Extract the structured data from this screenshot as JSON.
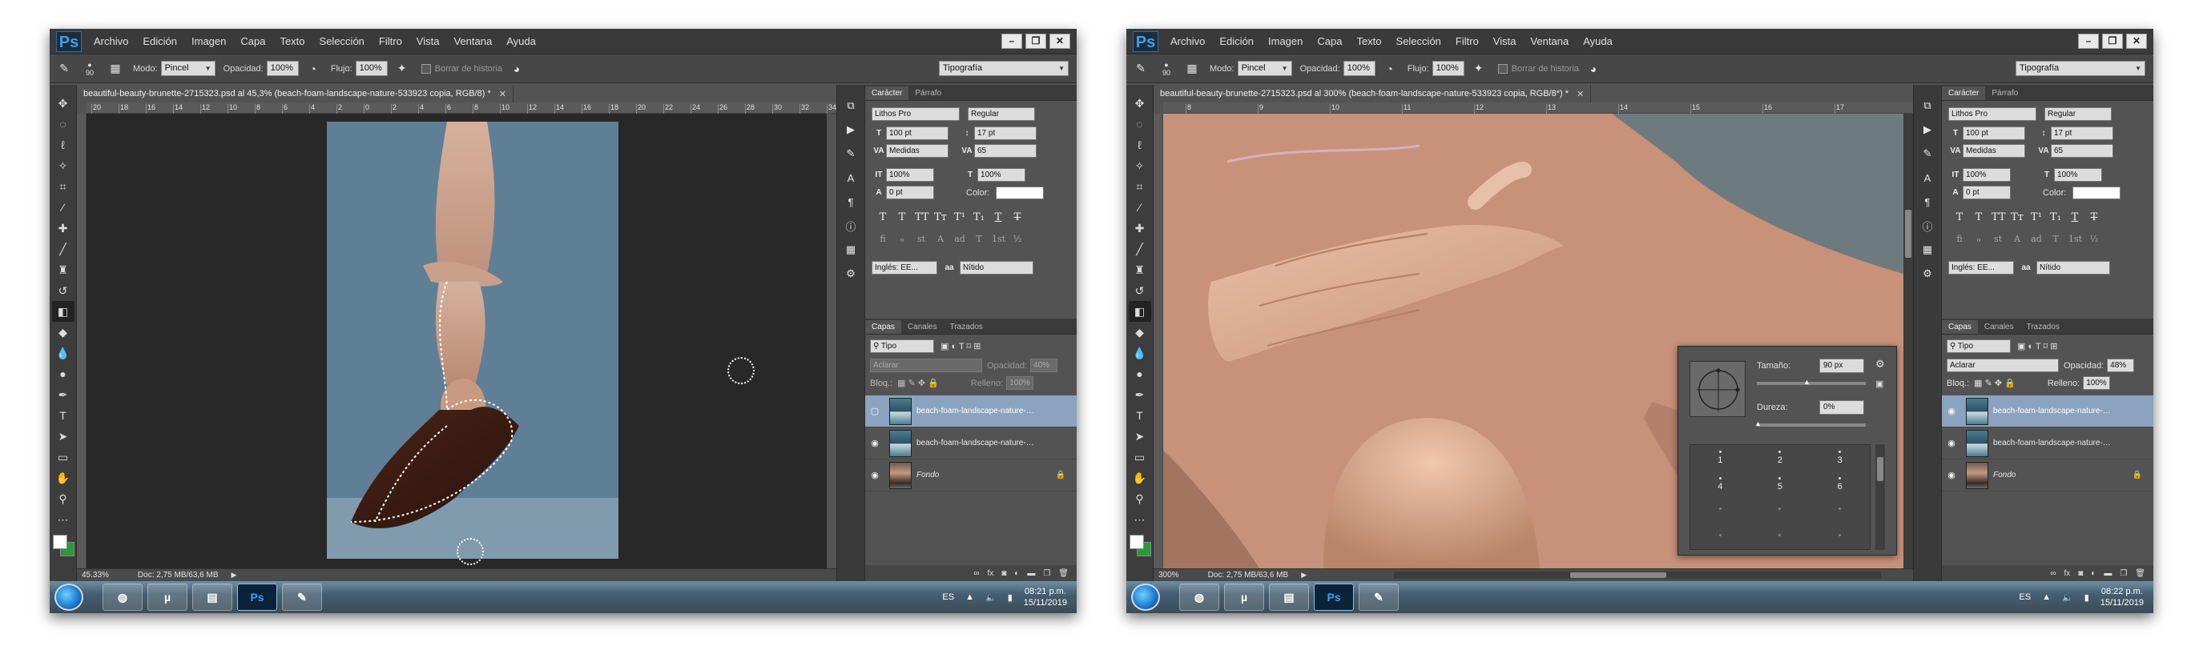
{
  "app": {
    "logo": "Ps"
  },
  "menu": [
    "Archivo",
    "Edición",
    "Imagen",
    "Capa",
    "Texto",
    "Selección",
    "Filtro",
    "Vista",
    "Ventana",
    "Ayuda"
  ],
  "window_buttons": {
    "minimize": "–",
    "restore": "❐",
    "close": "✕"
  },
  "options": {
    "brush_size": "90",
    "mode_label": "Modo:",
    "mode_value": "Pincel",
    "opacity_label": "Opacidad:",
    "opacity_value": "100%",
    "flow_label": "Flujo:",
    "flow_value": "100%",
    "erase_history_label": "Borrar de historia",
    "workspace": "Tipografía"
  },
  "character": {
    "tabs": [
      "Carácter",
      "Párrafo"
    ],
    "font_family": "Lithos Pro",
    "font_style": "Regular",
    "font_size": "100 pt",
    "leading": "17 pt",
    "kerning": "Medidas",
    "tracking": "65",
    "vertical_scale": "100%",
    "horizontal_scale": "100%",
    "baseline_shift": "0 pt",
    "color_label": "Color:",
    "language": "Inglés: EE...",
    "antialias": "Nítido",
    "glyphs": [
      "T",
      "T",
      "TT",
      "Tт",
      "T¹",
      "T₁",
      "T",
      "T"
    ],
    "opentype": [
      "ﬁ",
      "ℴ",
      "st",
      "A",
      "ad",
      "T",
      "1st",
      "½"
    ]
  },
  "layers": {
    "tabs": [
      "Capas",
      "Canales",
      "Trazados"
    ],
    "filter": "Tipo",
    "blend_mode": "Aclarar",
    "opacity_label": "Opacidad:",
    "fill_label": "Relleno:",
    "fill_value": "100%",
    "lock_label": "Bloq.:",
    "items": [
      {
        "name": "beach-foam-landscape-nature-533...",
        "selected": true
      },
      {
        "name": "beach-foam-landscape-nature-533...",
        "selected": false
      },
      {
        "name": "Fondo",
        "selected": false
      }
    ],
    "footer_icons": [
      "link-icon",
      "fx",
      "mask-icon",
      "adjustment-icon",
      "folder-icon",
      "new-layer-icon",
      "trash-icon"
    ]
  },
  "left": {
    "doc_tab": "beautiful-beauty-brunette-2715323.psd al 45,3% (beach-foam-landscape-nature-533923 copia, RGB/8) *",
    "zoom": "45.33%",
    "doc_size": "Doc: 2,75 MB/63,6 MB",
    "layer_opacity": "40%",
    "ruler": [
      "20",
      "18",
      "16",
      "14",
      "12",
      "10",
      "8",
      "6",
      "4",
      "2",
      "0",
      "2",
      "4",
      "6",
      "8",
      "10",
      "12",
      "14",
      "16",
      "18",
      "20",
      "22",
      "24",
      "26",
      "28",
      "30",
      "32",
      "34"
    ],
    "time": "08:21 p.m.",
    "date": "15/11/2019"
  },
  "right": {
    "doc_tab": "beautiful-beauty-brunette-2715323.psd al 300% (beach-foam-landscape-nature-533923 copia, RGB/8*) *",
    "zoom": "300%",
    "doc_size": "Doc: 2,75 MB/63,6 MB",
    "layer_opacity": "48%",
    "ruler": [
      "8",
      "9",
      "10",
      "11",
      "12",
      "13",
      "14",
      "15",
      "16",
      "17"
    ],
    "time": "08:22 p.m.",
    "date": "15/11/2019",
    "brush_popup": {
      "size_label": "Tamaño:",
      "size_value": "90 px",
      "hardness_label": "Dureza:",
      "hardness_value": "0%",
      "presets": [
        "1",
        "2",
        "3",
        "4",
        "5",
        "6",
        "",
        "",
        "",
        "",
        "",
        ""
      ]
    }
  },
  "taskbar": {
    "language": "ES"
  }
}
